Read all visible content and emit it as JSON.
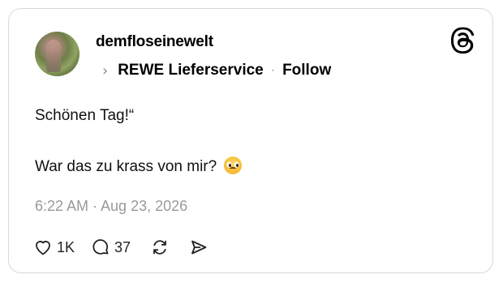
{
  "post": {
    "username": "demfloseinewelt",
    "channel": "REWE Lieferservice",
    "separator": "·",
    "follow_label": "Follow",
    "line1": "Schönen Tag!“",
    "line2": "War das zu krass von mir?",
    "emoji": "pleading-face-emoji",
    "timestamp": "6:22 AM · Aug 23, 2026"
  },
  "actions": {
    "likes": "1K",
    "replies": "37"
  },
  "icons": {
    "brand": "threads-logo-icon",
    "chevron": "chevron-right-icon",
    "like": "heart-icon",
    "reply": "comment-bubble-icon",
    "repost": "repost-icon",
    "share": "send-icon"
  },
  "colors": {
    "text": "#000000",
    "muted": "#9a9a9a",
    "border": "#d9d9d9"
  }
}
